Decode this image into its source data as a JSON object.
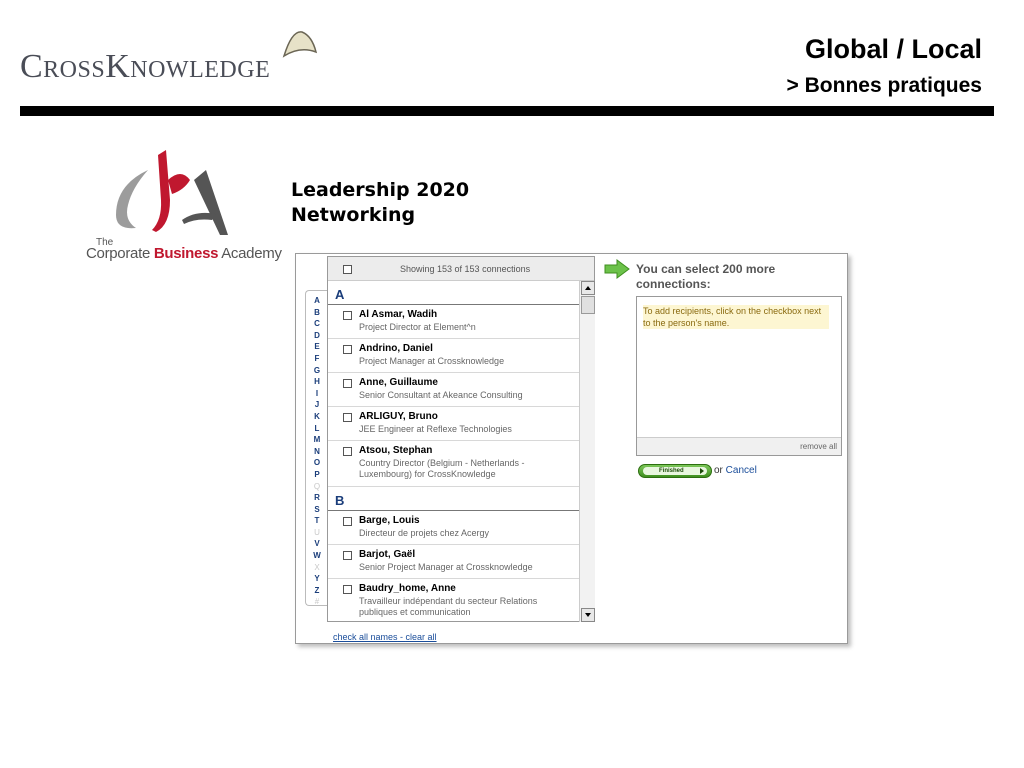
{
  "header": {
    "logo_text": "CrossKnowledge",
    "title": "Global / Local",
    "subtitle": "> Bonnes pratiques"
  },
  "cba_logo": {
    "the": "The",
    "name_part1": "Corporate ",
    "name_part2": "Business",
    "name_part3": " Academy"
  },
  "slide": {
    "title_line1": "Leadership 2020",
    "title_line2": "Networking"
  },
  "alphabet": [
    {
      "letter": "A",
      "enabled": true
    },
    {
      "letter": "B",
      "enabled": true
    },
    {
      "letter": "C",
      "enabled": true
    },
    {
      "letter": "D",
      "enabled": true
    },
    {
      "letter": "E",
      "enabled": true
    },
    {
      "letter": "F",
      "enabled": true
    },
    {
      "letter": "G",
      "enabled": true
    },
    {
      "letter": "H",
      "enabled": true
    },
    {
      "letter": "I",
      "enabled": true
    },
    {
      "letter": "J",
      "enabled": true
    },
    {
      "letter": "K",
      "enabled": true
    },
    {
      "letter": "L",
      "enabled": true
    },
    {
      "letter": "M",
      "enabled": true
    },
    {
      "letter": "N",
      "enabled": true
    },
    {
      "letter": "O",
      "enabled": true
    },
    {
      "letter": "P",
      "enabled": true
    },
    {
      "letter": "Q",
      "enabled": false
    },
    {
      "letter": "R",
      "enabled": true
    },
    {
      "letter": "S",
      "enabled": true
    },
    {
      "letter": "T",
      "enabled": true
    },
    {
      "letter": "U",
      "enabled": false
    },
    {
      "letter": "V",
      "enabled": true
    },
    {
      "letter": "W",
      "enabled": true
    },
    {
      "letter": "X",
      "enabled": false
    },
    {
      "letter": "Y",
      "enabled": true
    },
    {
      "letter": "Z",
      "enabled": true
    },
    {
      "letter": "#",
      "enabled": false
    }
  ],
  "connections": {
    "showing": "Showing 153 of 153 connections",
    "groups": [
      {
        "letter": "A",
        "people": [
          {
            "name": "Al Asmar, Wadih",
            "title": "Project Director at Element^n"
          },
          {
            "name": "Andrino, Daniel",
            "title": "Project Manager at Crossknowledge"
          },
          {
            "name": "Anne, Guillaume",
            "title": "Senior Consultant at Akeance Consulting"
          },
          {
            "name": "ARLIGUY, Bruno",
            "title": "JEE Engineer at Reflexe Technologies"
          },
          {
            "name": "Atsou, Stephan",
            "title": "Country Director (Belgium - Netherlands - Luxembourg) for CrossKnowledge"
          }
        ]
      },
      {
        "letter": "B",
        "people": [
          {
            "name": "Barge, Louis",
            "title": "Directeur de projets chez Acergy"
          },
          {
            "name": "Barjot, Gaël",
            "title": "Senior Project Manager at Crossknowledge"
          },
          {
            "name": "Baudry_home, Anne",
            "title": "Travailleur indépendant du secteur Relations publiques et communication"
          }
        ]
      }
    ],
    "footer_check_all": "check all names",
    "footer_sep": " - ",
    "footer_clear_all": "clear all"
  },
  "recipients": {
    "select_text": "You can select 200 more connections:",
    "hint": "To add recipients, click on the checkbox next to the person's name.",
    "remove_all": "remove all",
    "finished_label": "Finished",
    "or_text": "or ",
    "cancel_label": "Cancel"
  },
  "colors": {
    "accent_red": "#c0182f",
    "link_blue": "#1a4d9a",
    "letter_blue": "#1a3d7a",
    "finish_green": "#3f8f1f"
  }
}
